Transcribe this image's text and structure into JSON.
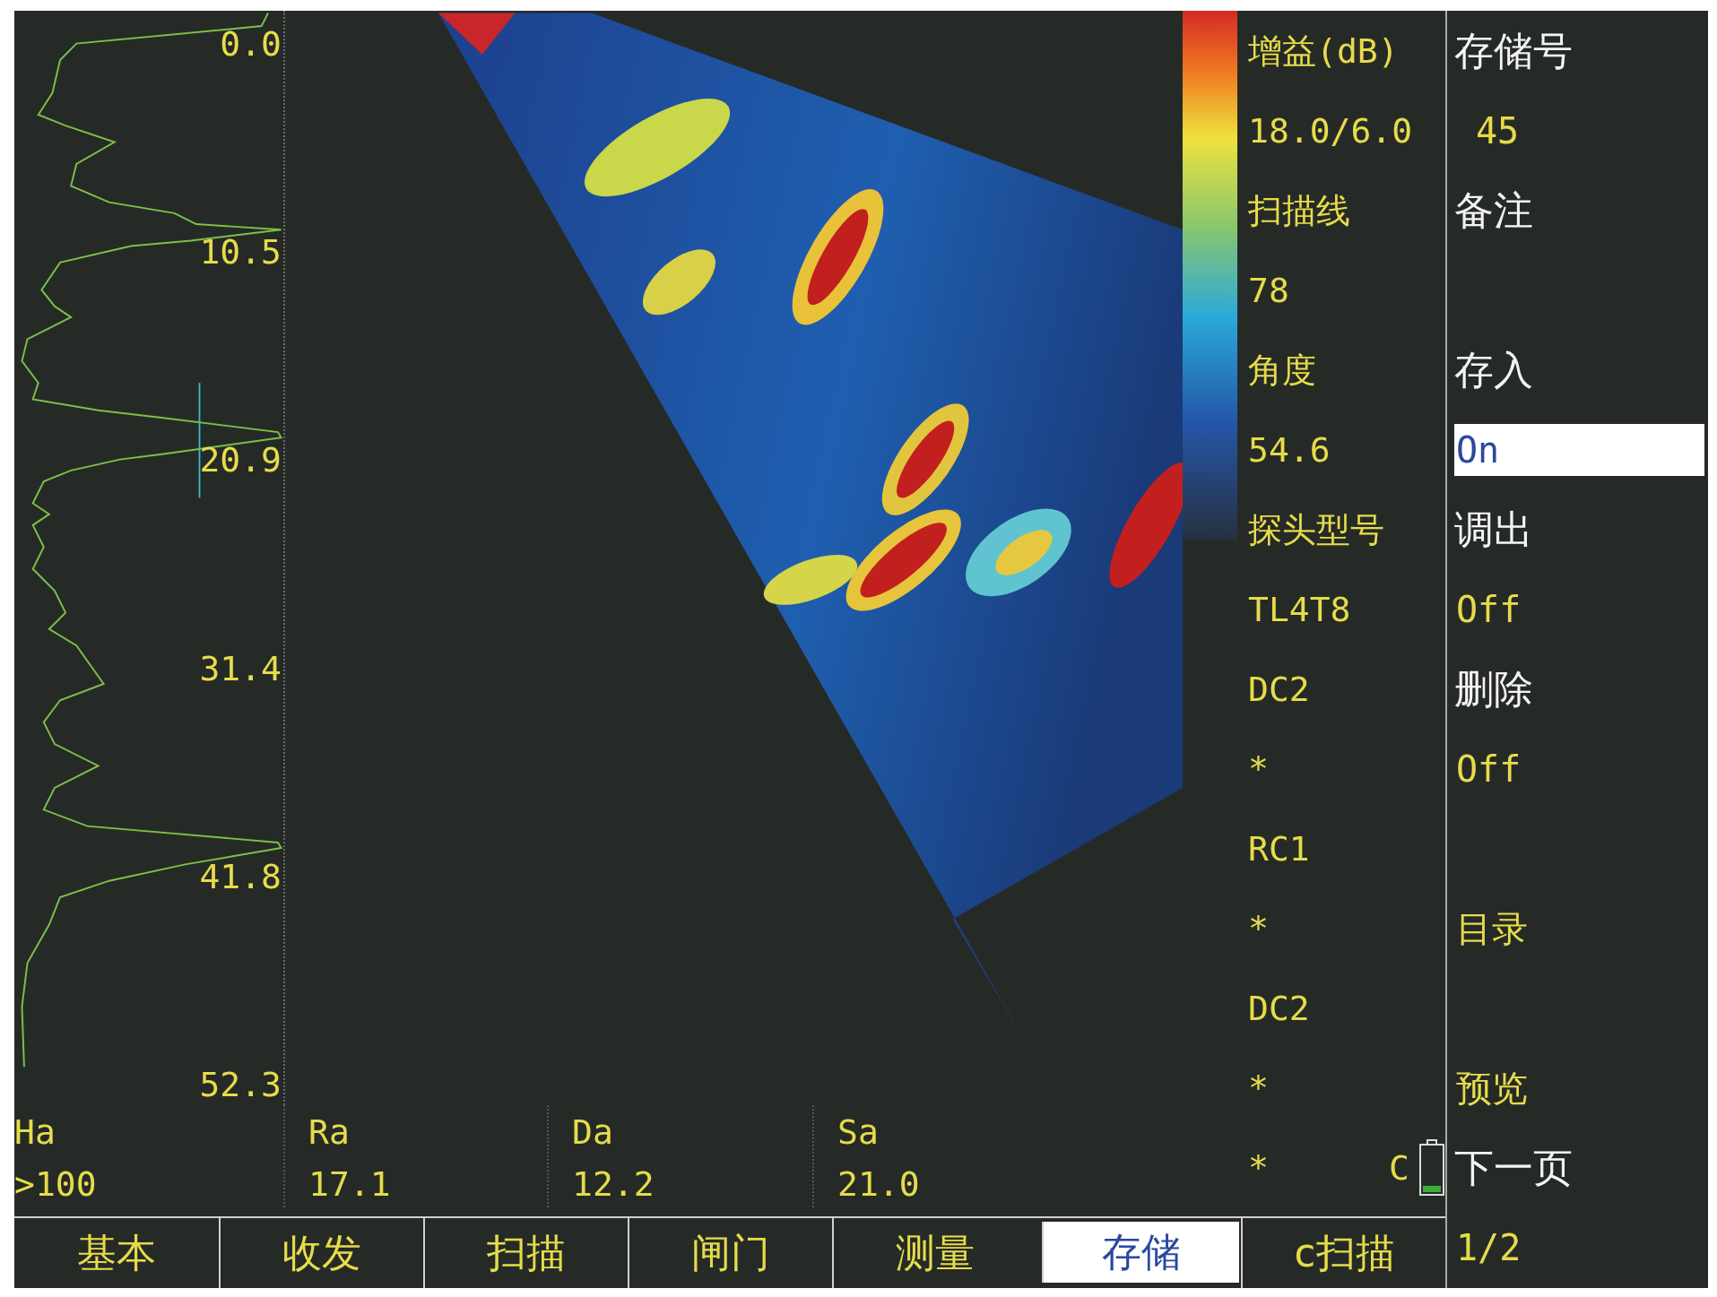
{
  "a_scan": {
    "depth_labels": [
      "0.0",
      "10.5",
      "20.9",
      "31.4",
      "41.8",
      "52.3"
    ]
  },
  "readouts": [
    {
      "label": "Ha",
      "value": ">100"
    },
    {
      "label": "Ra",
      "value": "17.1"
    },
    {
      "label": "Da",
      "value": "12.2"
    },
    {
      "label": "Sa",
      "value": "21.0"
    }
  ],
  "parameters": [
    "增益(dB)",
    "18.0/6.0",
    "扫描线",
    "78",
    "角度",
    "54.6",
    "探头型号",
    "TL4T8",
    "DC2",
    "*",
    "RC1",
    "*",
    "DC2",
    "*",
    "*"
  ],
  "channel": "C",
  "menu": [
    {
      "label": "存储号",
      "value": "45",
      "selected": false
    },
    {
      "label": "备注",
      "selected": false
    },
    {
      "label": "存入",
      "value": "On",
      "selected": true
    },
    {
      "label": "调出",
      "value": "Off",
      "selected": false
    },
    {
      "label": "删除",
      "value": "Off",
      "selected": false
    },
    {
      "value": "目录",
      "selected": false
    },
    {
      "value": "预览",
      "selected": false
    },
    {
      "label": "下一页",
      "value": "1/2",
      "selected": false
    }
  ],
  "tabs": [
    {
      "label": "基本",
      "selected": false
    },
    {
      "label": "收发",
      "selected": false
    },
    {
      "label": "扫描",
      "selected": false
    },
    {
      "label": "闸门",
      "selected": false
    },
    {
      "label": "测量",
      "selected": false
    },
    {
      "label": "存储",
      "selected": true
    },
    {
      "label": "c扫描",
      "selected": false
    }
  ]
}
